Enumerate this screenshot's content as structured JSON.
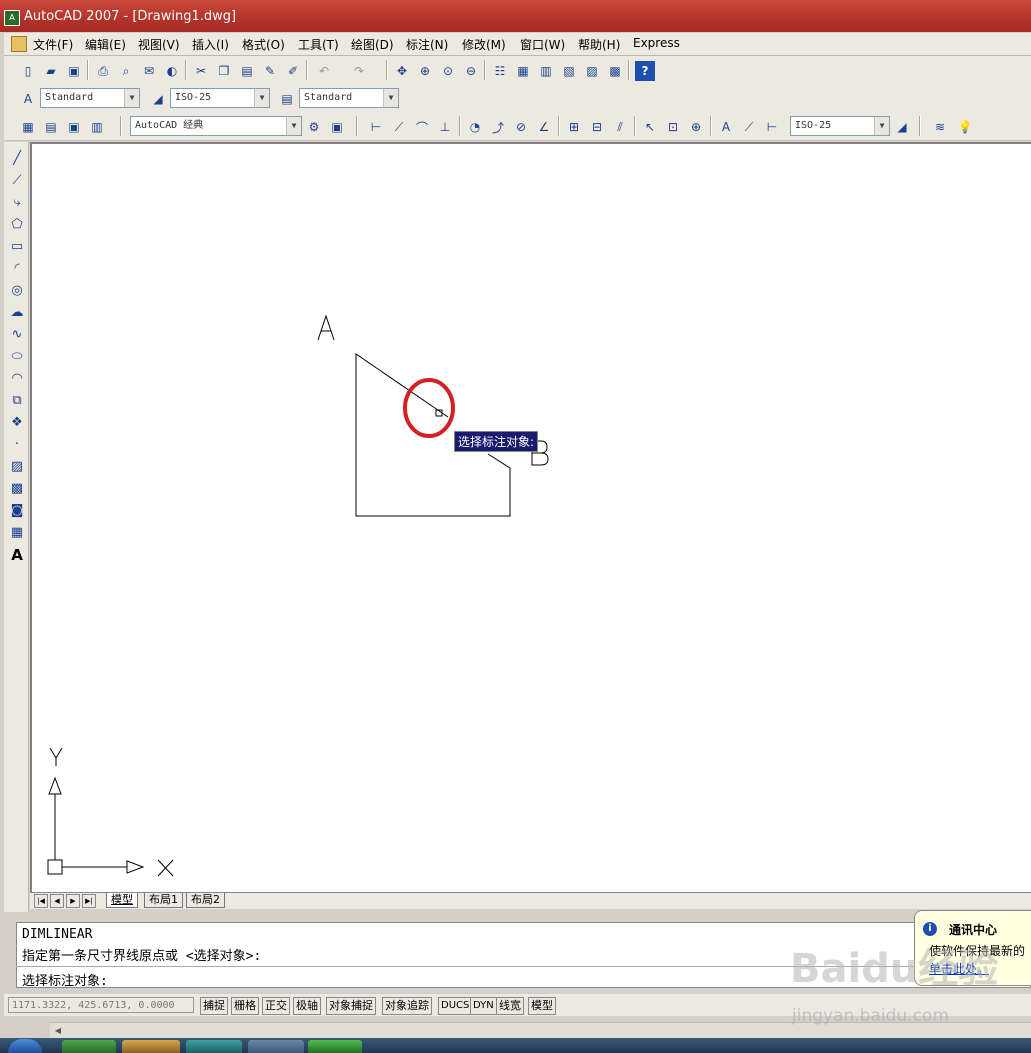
{
  "window": {
    "title": "AutoCAD 2007 - [Drawing1.dwg]"
  },
  "menubar": {
    "items": [
      {
        "label": "文件(F)"
      },
      {
        "label": "编辑(E)"
      },
      {
        "label": "视图(V)"
      },
      {
        "label": "插入(I)"
      },
      {
        "label": "格式(O)"
      },
      {
        "label": "工具(T)"
      },
      {
        "label": "绘图(D)"
      },
      {
        "label": "标注(N)"
      },
      {
        "label": "修改(M)"
      },
      {
        "label": "窗口(W)"
      },
      {
        "label": "帮助(H)"
      },
      {
        "label": "Express"
      }
    ]
  },
  "styles_toolbar": {
    "text_style": "Standard",
    "dim_style": "ISO-25",
    "table_style": "Standard"
  },
  "workspaces_toolbar": {
    "workspace": "AutoCAD 经典"
  },
  "dimension_toolbar": {
    "dim_style": "ISO-25"
  },
  "drawing": {
    "label_a": "A",
    "label_b": "B",
    "ucs_y": "Y",
    "ucs_x": "X"
  },
  "tooltip": {
    "text": "选择标注对象:"
  },
  "layout_tabs": [
    {
      "label": "模型"
    },
    {
      "label": "布局1"
    },
    {
      "label": "布局2"
    }
  ],
  "command": {
    "line1": "DIMLINEAR",
    "line2": "指定第一条尺寸界线原点或 <选择对象>:",
    "prompt": "选择标注对象:"
  },
  "statusbar": {
    "coords": "1171.3322, 425.6713, 0.0000",
    "buttons": [
      {
        "label": "捕捉"
      },
      {
        "label": "栅格"
      },
      {
        "label": "正交"
      },
      {
        "label": "极轴"
      },
      {
        "label": "对象捕捉"
      },
      {
        "label": "对象追踪"
      },
      {
        "label": "DUCS"
      },
      {
        "label": "DYN"
      },
      {
        "label": "线宽"
      },
      {
        "label": "模型"
      }
    ]
  },
  "notification": {
    "title": "通讯中心",
    "body": "使软件保持最新的",
    "link": "单击此处。"
  },
  "watermark": {
    "brand": "Baidu经验",
    "url": "jingyan.baidu.com"
  },
  "colors": {
    "title_bar": "#b3322a",
    "highlight_circle": "#d42020",
    "tooltip_bg": "#1a1a6e"
  }
}
